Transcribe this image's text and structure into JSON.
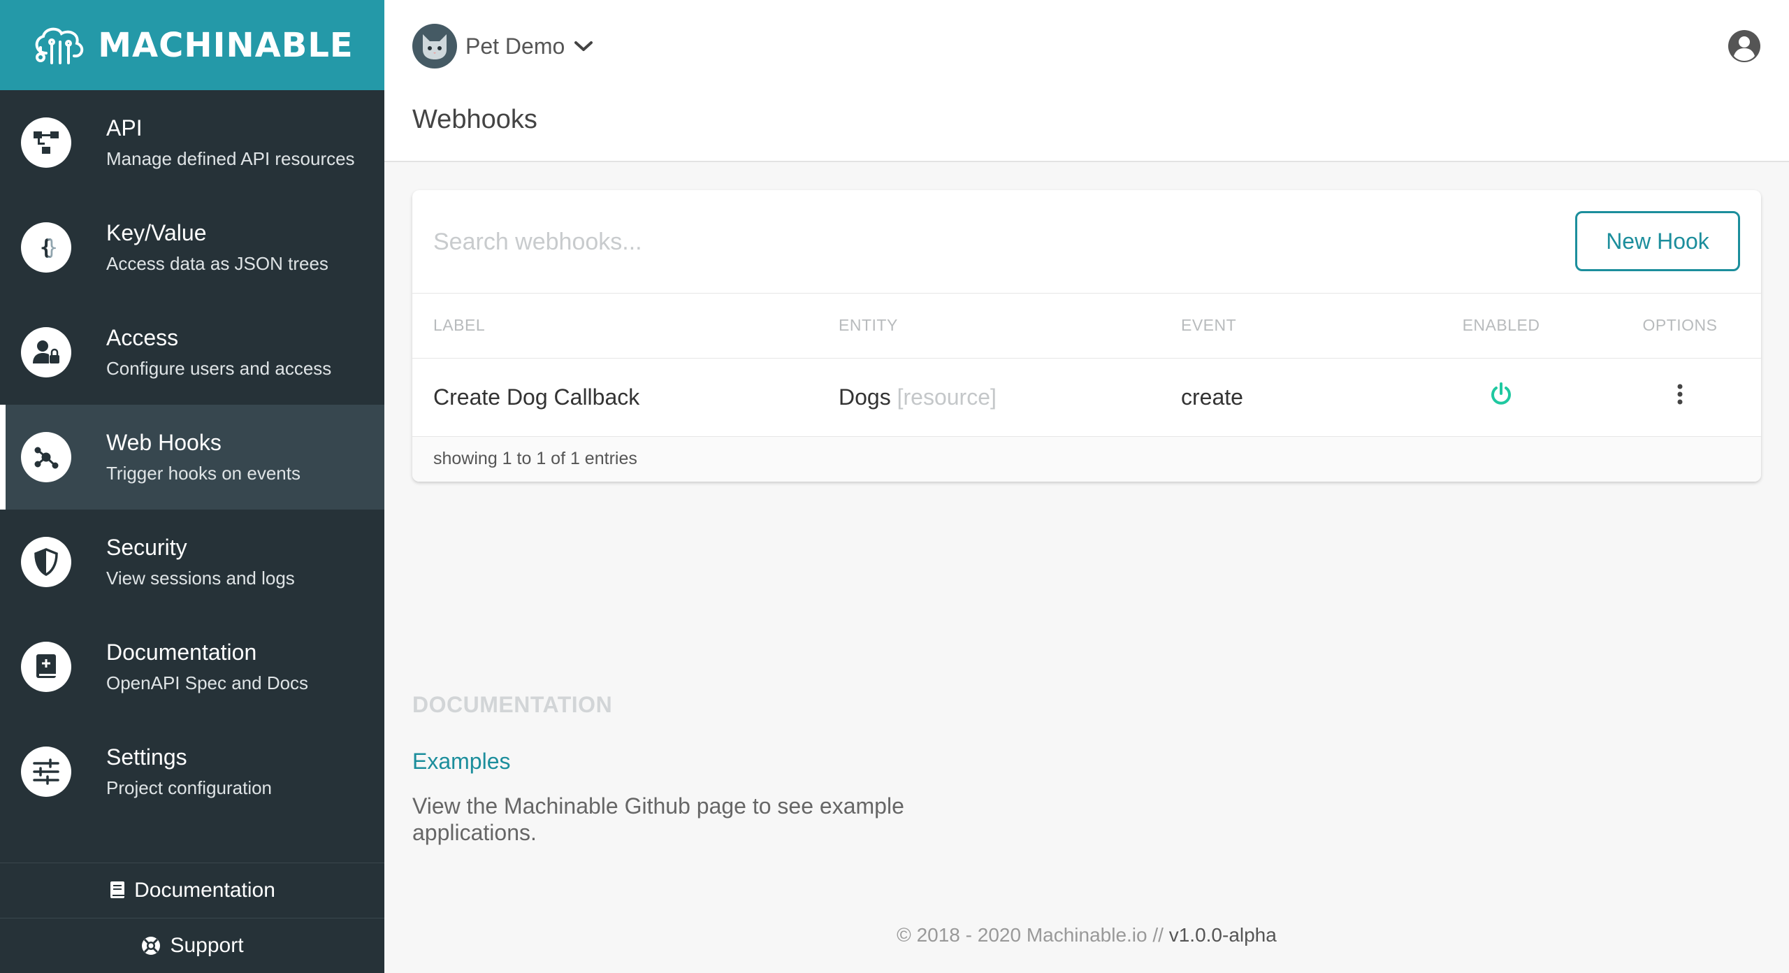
{
  "brand": {
    "name": "MACHINABLE"
  },
  "nav": [
    {
      "title": "API",
      "subtitle": "Manage defined API resources",
      "icon": "api-icon"
    },
    {
      "title": "Key/Value",
      "subtitle": "Access data as JSON trees",
      "icon": "braces-icon"
    },
    {
      "title": "Access",
      "subtitle": "Configure users and access",
      "icon": "user-lock-icon"
    },
    {
      "title": "Web Hooks",
      "subtitle": "Trigger hooks on events",
      "icon": "webhook-icon",
      "active": true
    },
    {
      "title": "Security",
      "subtitle": "View sessions and logs",
      "icon": "shield-icon"
    },
    {
      "title": "Documentation",
      "subtitle": "OpenAPI Spec and Docs",
      "icon": "book-icon"
    },
    {
      "title": "Settings",
      "subtitle": "Project configuration",
      "icon": "sliders-icon"
    }
  ],
  "sidebar_footer": {
    "documentation": "Documentation",
    "support": "Support"
  },
  "header": {
    "project_name": "Pet Demo",
    "page_title": "Webhooks"
  },
  "search": {
    "placeholder": "Search webhooks..."
  },
  "toolbar": {
    "new_hook": "New Hook"
  },
  "table": {
    "columns": [
      "LABEL",
      "ENTITY",
      "EVENT",
      "ENABLED",
      "OPTIONS"
    ],
    "rows": [
      {
        "label": "Create Dog Callback",
        "entity": "Dogs",
        "entity_type": "[resource]",
        "event": "create",
        "enabled": true
      }
    ],
    "footer": "showing 1 to 1 of 1 entries"
  },
  "docs": {
    "heading": "DOCUMENTATION",
    "link": "Examples",
    "description": "View the Machinable Github page to see example applications."
  },
  "footer": {
    "copyright": "© 2018 - 2020 Machinable.io // ",
    "version": "v1.0.0-alpha"
  },
  "colors": {
    "brand": "#2499a8",
    "sidebar": "#263238",
    "accent": "#1c8e9c",
    "enabled": "#1fc8a0"
  }
}
